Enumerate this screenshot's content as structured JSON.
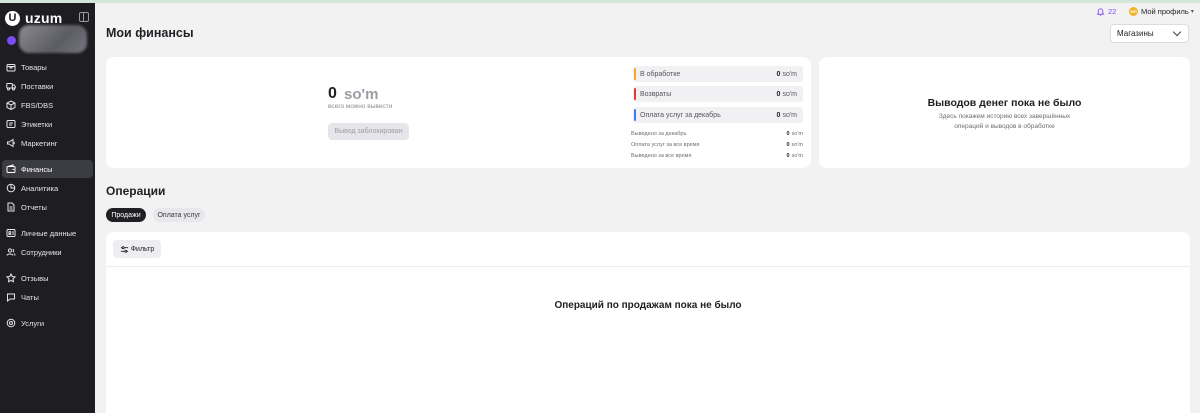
{
  "app": {
    "brand": "uzum",
    "brand_mark": "U",
    "shop_name": ""
  },
  "sidebar": {
    "items": [
      {
        "label": "Товары",
        "icon": "box-icon",
        "active": false
      },
      {
        "label": "Поставки",
        "icon": "truck-icon",
        "active": false
      },
      {
        "label": "FBS/DBS",
        "icon": "package-icon",
        "active": false
      },
      {
        "label": "Этикетки",
        "icon": "tag-icon",
        "active": false
      },
      {
        "label": "Маркетинг",
        "icon": "megaphone-icon",
        "active": false
      },
      {
        "label": "Финансы",
        "icon": "wallet-icon",
        "active": true
      },
      {
        "label": "Аналитика",
        "icon": "chart-icon",
        "active": false
      },
      {
        "label": "Отчеты",
        "icon": "document-icon",
        "active": false
      },
      {
        "label": "Личные данные",
        "icon": "id-card-icon",
        "active": false
      },
      {
        "label": "Сотрудники",
        "icon": "users-icon",
        "active": false
      },
      {
        "label": "Отзывы",
        "icon": "star-icon",
        "active": false
      },
      {
        "label": "Чаты",
        "icon": "chat-icon",
        "active": false
      },
      {
        "label": "Услуги",
        "icon": "services-icon",
        "active": false
      }
    ]
  },
  "header": {
    "title": "Мои финансы",
    "notifications_count": "22",
    "profile_label": "Мой профиль",
    "profile_initials": "МП",
    "stores_select": "Магазины"
  },
  "balance": {
    "amount": "0",
    "currency": "so'm",
    "subtitle": "всего можно вывести",
    "withdraw_button": "Вывод заблокирован",
    "stats": [
      {
        "label": "В обработке",
        "value": "0",
        "currency": "so'm",
        "color": "#f5a623"
      },
      {
        "label": "Возвраты",
        "value": "0",
        "currency": "so'm",
        "color": "#e53935"
      },
      {
        "label": "Оплата услуг за декабрь",
        "value": "0",
        "currency": "so'm",
        "color": "#3d7bf6"
      }
    ],
    "summary": [
      {
        "label": "Выведено за декабрь",
        "value": "0",
        "currency": "so'm"
      },
      {
        "label": "Оплата услуг за все время",
        "value": "0",
        "currency": "so'm"
      },
      {
        "label": "Выведено за все время",
        "value": "0",
        "currency": "so'm"
      }
    ]
  },
  "history": {
    "title": "Выводов денег пока не было",
    "text": "Здесь покажем историю всех завершённых операций и выводов в обработке"
  },
  "operations": {
    "title": "Операции",
    "tabs": [
      {
        "label": "Продажи",
        "active": true
      },
      {
        "label": "Оплата услуг",
        "active": false
      }
    ],
    "filter_button": "Фильтр",
    "empty_text": "Операций по продажам пока не было"
  }
}
